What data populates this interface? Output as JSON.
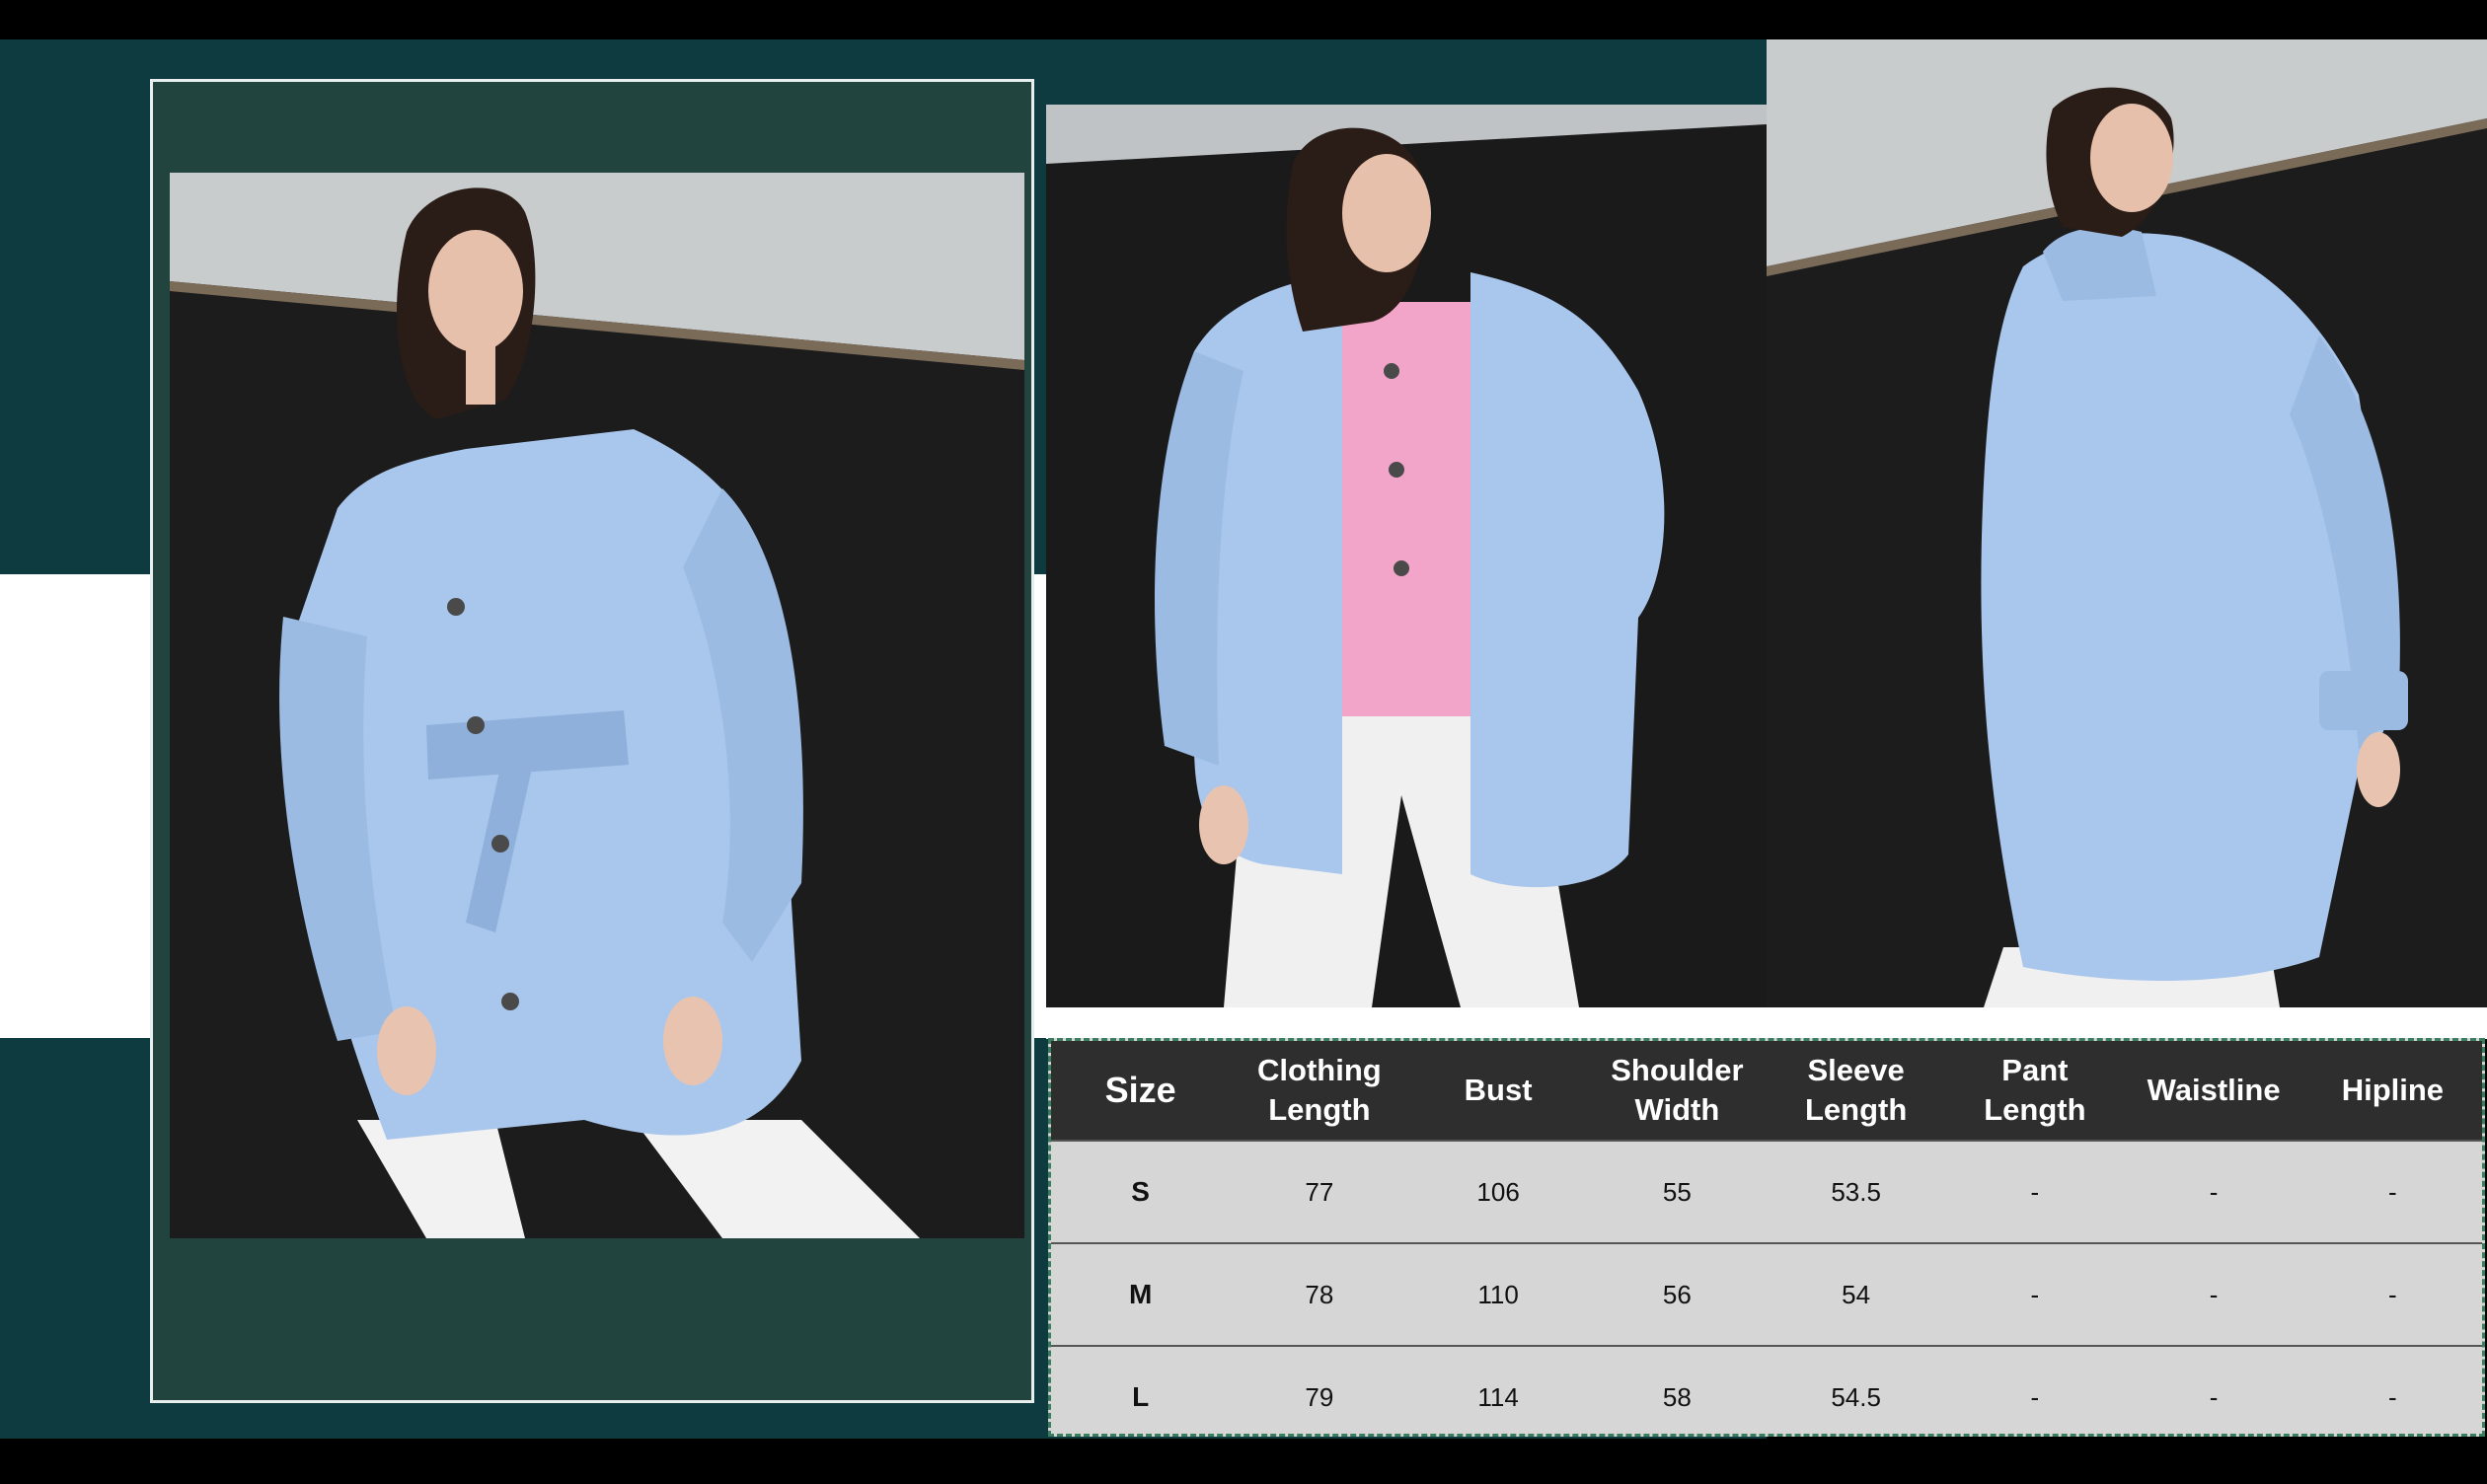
{
  "images": {
    "main": {
      "subject": "model-in-light-blue-belted-shirt-jacket"
    },
    "middle": {
      "subject": "model-in-light-blue-shirt-jacket-front"
    },
    "right": {
      "subject": "model-in-light-blue-shirt-jacket-back"
    }
  },
  "colors": {
    "teal_background": "#0d3b3f",
    "frame_panel": "#21443f",
    "jacket_blue": "#a9c6ec",
    "table_header": "#2e2e2e",
    "table_body": "#d6d6d6"
  },
  "size_table": {
    "headers": [
      "Size",
      "Clothing\nLength",
      "Bust",
      "Shoulder\nWidth",
      "Sleeve\nLength",
      "Pant\nLength",
      "Waistline",
      "Hipline"
    ],
    "rows": [
      [
        "S",
        "77",
        "106",
        "55",
        "53.5",
        "-",
        "-",
        "-"
      ],
      [
        "M",
        "78",
        "110",
        "56",
        "54",
        "-",
        "-",
        "-"
      ],
      [
        "L",
        "79",
        "114",
        "58",
        "54.5",
        "-",
        "-",
        "-"
      ]
    ]
  }
}
